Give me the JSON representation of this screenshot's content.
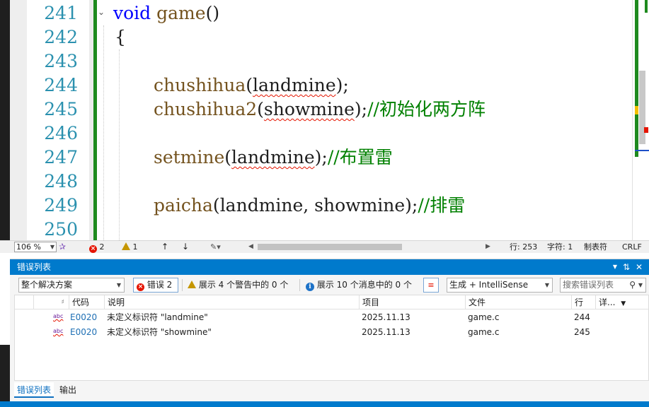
{
  "editor": {
    "lines": [
      {
        "num": "241",
        "type": "func",
        "kw": "void",
        "name": "game",
        "rest": "()"
      },
      {
        "num": "242",
        "type": "text",
        "text": "{"
      },
      {
        "num": "243",
        "type": "blank"
      },
      {
        "num": "244",
        "type": "call",
        "fn": "chushihua",
        "open": "(",
        "arg": "landmine",
        "close": ");",
        "comment": ""
      },
      {
        "num": "245",
        "type": "call",
        "fn": "chushihua2",
        "open": "(",
        "arg": "showmine",
        "close": ");",
        "comment": "//初始化两方阵"
      },
      {
        "num": "246",
        "type": "blank"
      },
      {
        "num": "247",
        "type": "call",
        "fn": "setmine",
        "open": "(",
        "arg": "landmine",
        "close": ");",
        "comment": "//布置雷"
      },
      {
        "num": "248",
        "type": "blank"
      },
      {
        "num": "249",
        "type": "call",
        "fn": "paicha",
        "open": "(",
        "arg": "landmine, showmine",
        "close": ");",
        "comment": "//排雷"
      },
      {
        "num": "250",
        "type": "blank"
      }
    ],
    "squiggly_args": [
      "landmine",
      "showmine"
    ]
  },
  "status_bar": {
    "zoom": "106 %",
    "errors": "2",
    "warnings": "1",
    "line": "行: 253",
    "char": "字符: 1",
    "tabs": "制表符",
    "eol": "CRLF"
  },
  "error_list": {
    "title": "错误列表",
    "scope": "整个解决方案",
    "errors_btn": "错误 2",
    "warnings_btn": "展示 4 个警告中的 0 个",
    "messages_btn": "展示 10 个消息中的 0 个",
    "build_filter": "生成 + IntelliSense",
    "search_placeholder": "搜索错误列表",
    "columns": {
      "code": "代码",
      "description": "说明",
      "project": "项目",
      "file": "文件",
      "line": "行",
      "details": "详..."
    },
    "rows": [
      {
        "code": "E0020",
        "description": "未定义标识符 \"landmine\"",
        "project": "2025.11.13",
        "file": "game.c",
        "line": "244"
      },
      {
        "code": "E0020",
        "description": "未定义标识符 \"showmine\"",
        "project": "2025.11.13",
        "file": "game.c",
        "line": "245"
      }
    ],
    "tabs": [
      "错误列表",
      "输出"
    ]
  },
  "colors": {
    "accent": "#007acc",
    "keyword": "#0000ff",
    "function": "#74531f",
    "comment": "#008000",
    "line_number": "#2b91af",
    "change_bar": "#1e8a1e",
    "error": "#e51400"
  }
}
